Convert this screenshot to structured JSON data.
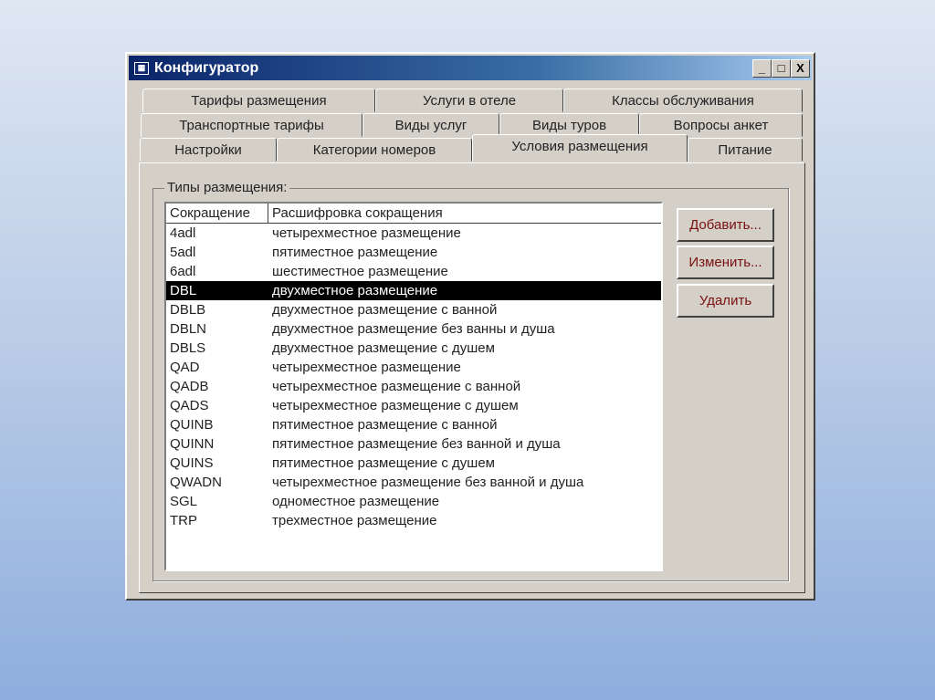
{
  "window": {
    "title": "Конфигуратор",
    "minimize": "_",
    "maximize": "□",
    "close": "X"
  },
  "tabs": {
    "row1": [
      "Тарифы размещения",
      "Услуги в отеле",
      "Классы обслуживания"
    ],
    "row2": [
      "Транспортные тарифы",
      "Виды услуг",
      "Виды туров",
      "Вопросы анкет"
    ],
    "row3": [
      "Настройки",
      "Категории номеров",
      "Условия размещения",
      "Питание"
    ],
    "active": "Условия размещения"
  },
  "group": {
    "label": "Типы размещения:"
  },
  "list": {
    "headers": [
      "Сокращение",
      "Расшифровка сокращения"
    ],
    "selected_index": 3,
    "rows": [
      [
        "4adl",
        "четырехместное размещение"
      ],
      [
        "5adl",
        "пятиместное размещение"
      ],
      [
        "6adl",
        "шестиместное размещение"
      ],
      [
        "DBL",
        "двухместное размещение"
      ],
      [
        "DBLB",
        "двухместное размещение с ванной"
      ],
      [
        "DBLN",
        "двухместное размещение без ванны и душа"
      ],
      [
        "DBLS",
        "двухместное размещение с  душем"
      ],
      [
        "QAD",
        "четырехместное размещение"
      ],
      [
        "QADB",
        "четырехместное размещение с ванной"
      ],
      [
        "QADS",
        "четырехместное размещение с душем"
      ],
      [
        "QUINB",
        "пятиместное размещение с ванной"
      ],
      [
        "QUINN",
        "пятиместное размещение без ванной и  душа"
      ],
      [
        "QUINS",
        "пятиместное размещение с душем"
      ],
      [
        "QWADN",
        "четырехместное размещение без ванной и  душа"
      ],
      [
        "SGL",
        "одноместное размещение"
      ],
      [
        "TRP",
        "трехместное размещение"
      ]
    ]
  },
  "buttons": {
    "add": "Добавить...",
    "edit": "Изменить...",
    "delete": "Удалить"
  }
}
